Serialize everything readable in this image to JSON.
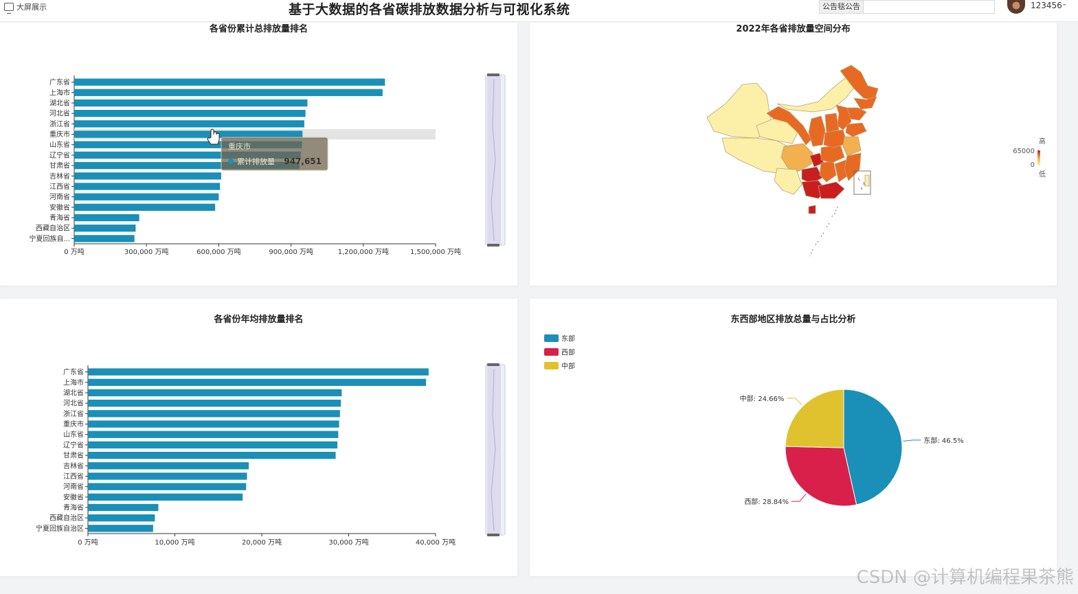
{
  "header": {
    "screen_label": "大屏展示",
    "title": "基于大数据的各省碳排放数据分析与可视化系统",
    "notice_label": "公告毯公告",
    "username": "123456",
    "caret": "⌄"
  },
  "watermark": "CSDN @计算机编程果茶熊",
  "tooltip": {
    "title": "重庆市",
    "series": "累计排放量",
    "value": "947,651",
    "color": "#1a8fb7"
  },
  "map_legend": {
    "high": "高",
    "max": "65000",
    "min": "0",
    "low": "低"
  },
  "chart_data": [
    {
      "type": "bar",
      "title": "各省份累计总排放量排名",
      "categories": [
        "广东省",
        "上海市",
        "湖北省",
        "河北省",
        "浙江省",
        "重庆市",
        "山东省",
        "辽宁省",
        "甘肃省",
        "吉林省",
        "江西省",
        "河南省",
        "安徽省",
        "青海省",
        "西藏自治区",
        "宁夏回族自..."
      ],
      "values": [
        1290000,
        1280000,
        968000,
        960000,
        955000,
        947651,
        945000,
        940000,
        935000,
        610000,
        605000,
        600000,
        585000,
        270000,
        255000,
        250000
      ],
      "xlim": [
        0,
        1500000
      ],
      "xticks": [
        "0 万吨",
        "300,000 万吨",
        "600,000 万吨",
        "900,000 万吨",
        "1,200,000 万吨",
        "1,500,000 万吨"
      ],
      "color": "#1a8fb7"
    },
    {
      "type": "map",
      "title": "2022年各省排放量空间分布",
      "visual_range": [
        0,
        65000
      ],
      "colors": [
        "#fcefa8",
        "#f2b04e",
        "#e86a22",
        "#c91e1e"
      ]
    },
    {
      "type": "bar",
      "title": "各省份年均排放量排名",
      "categories": [
        "广东省",
        "上海市",
        "湖北省",
        "河北省",
        "浙江省",
        "重庆市",
        "山东省",
        "辽宁省",
        "甘肃省",
        "吉林省",
        "江西省",
        "河南省",
        "安徽省",
        "青海省",
        "西藏自治区",
        "宁夏回族自治区"
      ],
      "values": [
        39200,
        38900,
        29200,
        29100,
        29000,
        28900,
        28800,
        28700,
        28500,
        18500,
        18300,
        18200,
        17800,
        8100,
        7700,
        7500
      ],
      "xlim": [
        0,
        40000
      ],
      "xticks": [
        "0 万吨",
        "10,000 万吨",
        "20,000 万吨",
        "30,000 万吨",
        "40,000 万吨"
      ],
      "color": "#1a8fb7"
    },
    {
      "type": "pie",
      "title": "东西部地区排放总量与占比分析",
      "slices": [
        {
          "name": "东部",
          "value": 46.5,
          "label": "东部: 46.5%",
          "color": "#1a8fb7"
        },
        {
          "name": "西部",
          "value": 28.84,
          "label": "西部: 28.84%",
          "color": "#d8204b"
        },
        {
          "name": "中部",
          "value": 24.66,
          "label": "中部: 24.66%",
          "color": "#e0c22f"
        }
      ]
    }
  ]
}
